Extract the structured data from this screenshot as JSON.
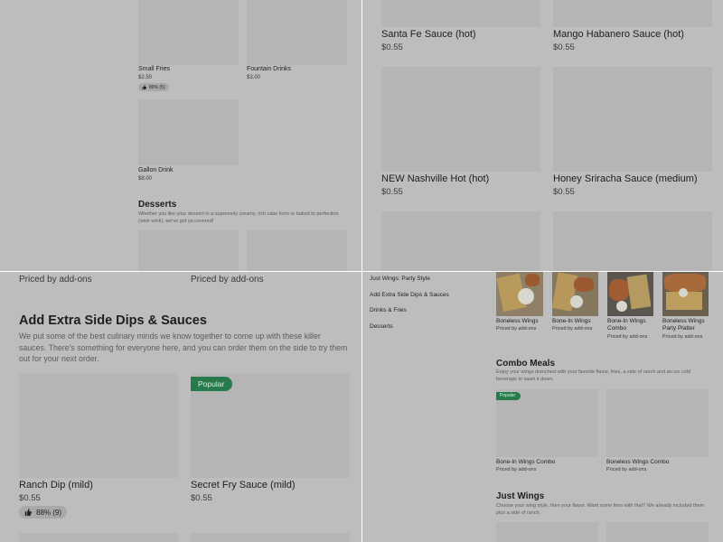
{
  "q1": {
    "small_fries": {
      "name": "Small Fries",
      "price": "$2.50",
      "rating": "80% (5)"
    },
    "fountain_drinks": {
      "name": "Fountain Drinks",
      "price": "$3.00"
    },
    "gallon_drink": {
      "name": "Gallon Drink",
      "price": "$8.00"
    },
    "desserts": {
      "title": "Desserts",
      "description": "Whether you like your dessert in a supremely creamy, rich cake form or baked to perfection (wink wink), we've got ya covered!"
    }
  },
  "q2": {
    "items": [
      {
        "name": "Santa Fe Sauce (hot)",
        "price": "$0.55"
      },
      {
        "name": "Mango Habanero Sauce (hot)",
        "price": "$0.55"
      },
      {
        "name": "NEW Nashville Hot (hot)",
        "price": "$0.55"
      },
      {
        "name": "Honey Sriracha Sauce (medium)",
        "price": "$0.55"
      }
    ]
  },
  "q3": {
    "priced_by": "Priced by add-ons",
    "section": {
      "title": "Add Extra Side Dips & Sauces",
      "description": "We put some of the best culinary minds we know together to come up with these killer sauces. There's something for everyone here, and you can order them on the side to try them out for your next order."
    },
    "popular_badge": "Popular",
    "ranch": {
      "name": "Ranch Dip (mild)",
      "price": "$0.55",
      "rating": "88% (9)"
    },
    "secret": {
      "name": "Secret Fry Sauce (mild)",
      "price": "$0.55"
    }
  },
  "q4": {
    "nav": [
      "Just Wings: Party Style",
      "Add Extra Side Dips & Sauces",
      "Drinks & Fries",
      "Desserts"
    ],
    "wings": [
      {
        "name": "Boneless Wings",
        "priced": "Priced by add-ons"
      },
      {
        "name": "Bone-In Wings",
        "priced": "Priced by add-ons"
      },
      {
        "name": "Bone-In Wings Combo",
        "priced": "Priced by add-ons"
      },
      {
        "name": "Boneless Wings Party Platter",
        "priced": "Priced by add-ons"
      }
    ],
    "combo": {
      "title": "Combo Meals",
      "description": "Enjoy your wings drenched with your favorite flavor, fries, a side of ranch and an ice cold beverage to wash it down.",
      "popular_badge": "Popular",
      "items": [
        {
          "name": "Bone-In Wings Combo",
          "priced": "Priced by add-ons"
        },
        {
          "name": "Boneless Wings Combo",
          "priced": "Priced by add-ons"
        }
      ]
    },
    "just_wings": {
      "title": "Just Wings",
      "description": "Choose your wing style, then your flavor. Want some fries with that? We already included them plus a side of ranch."
    }
  },
  "colors": {
    "overlay_gray": "#bdbdbd",
    "placeholder": "#b5b5b5",
    "popular_green": "#277a4b"
  },
  "icons": [
    "thumbs-up-icon"
  ]
}
